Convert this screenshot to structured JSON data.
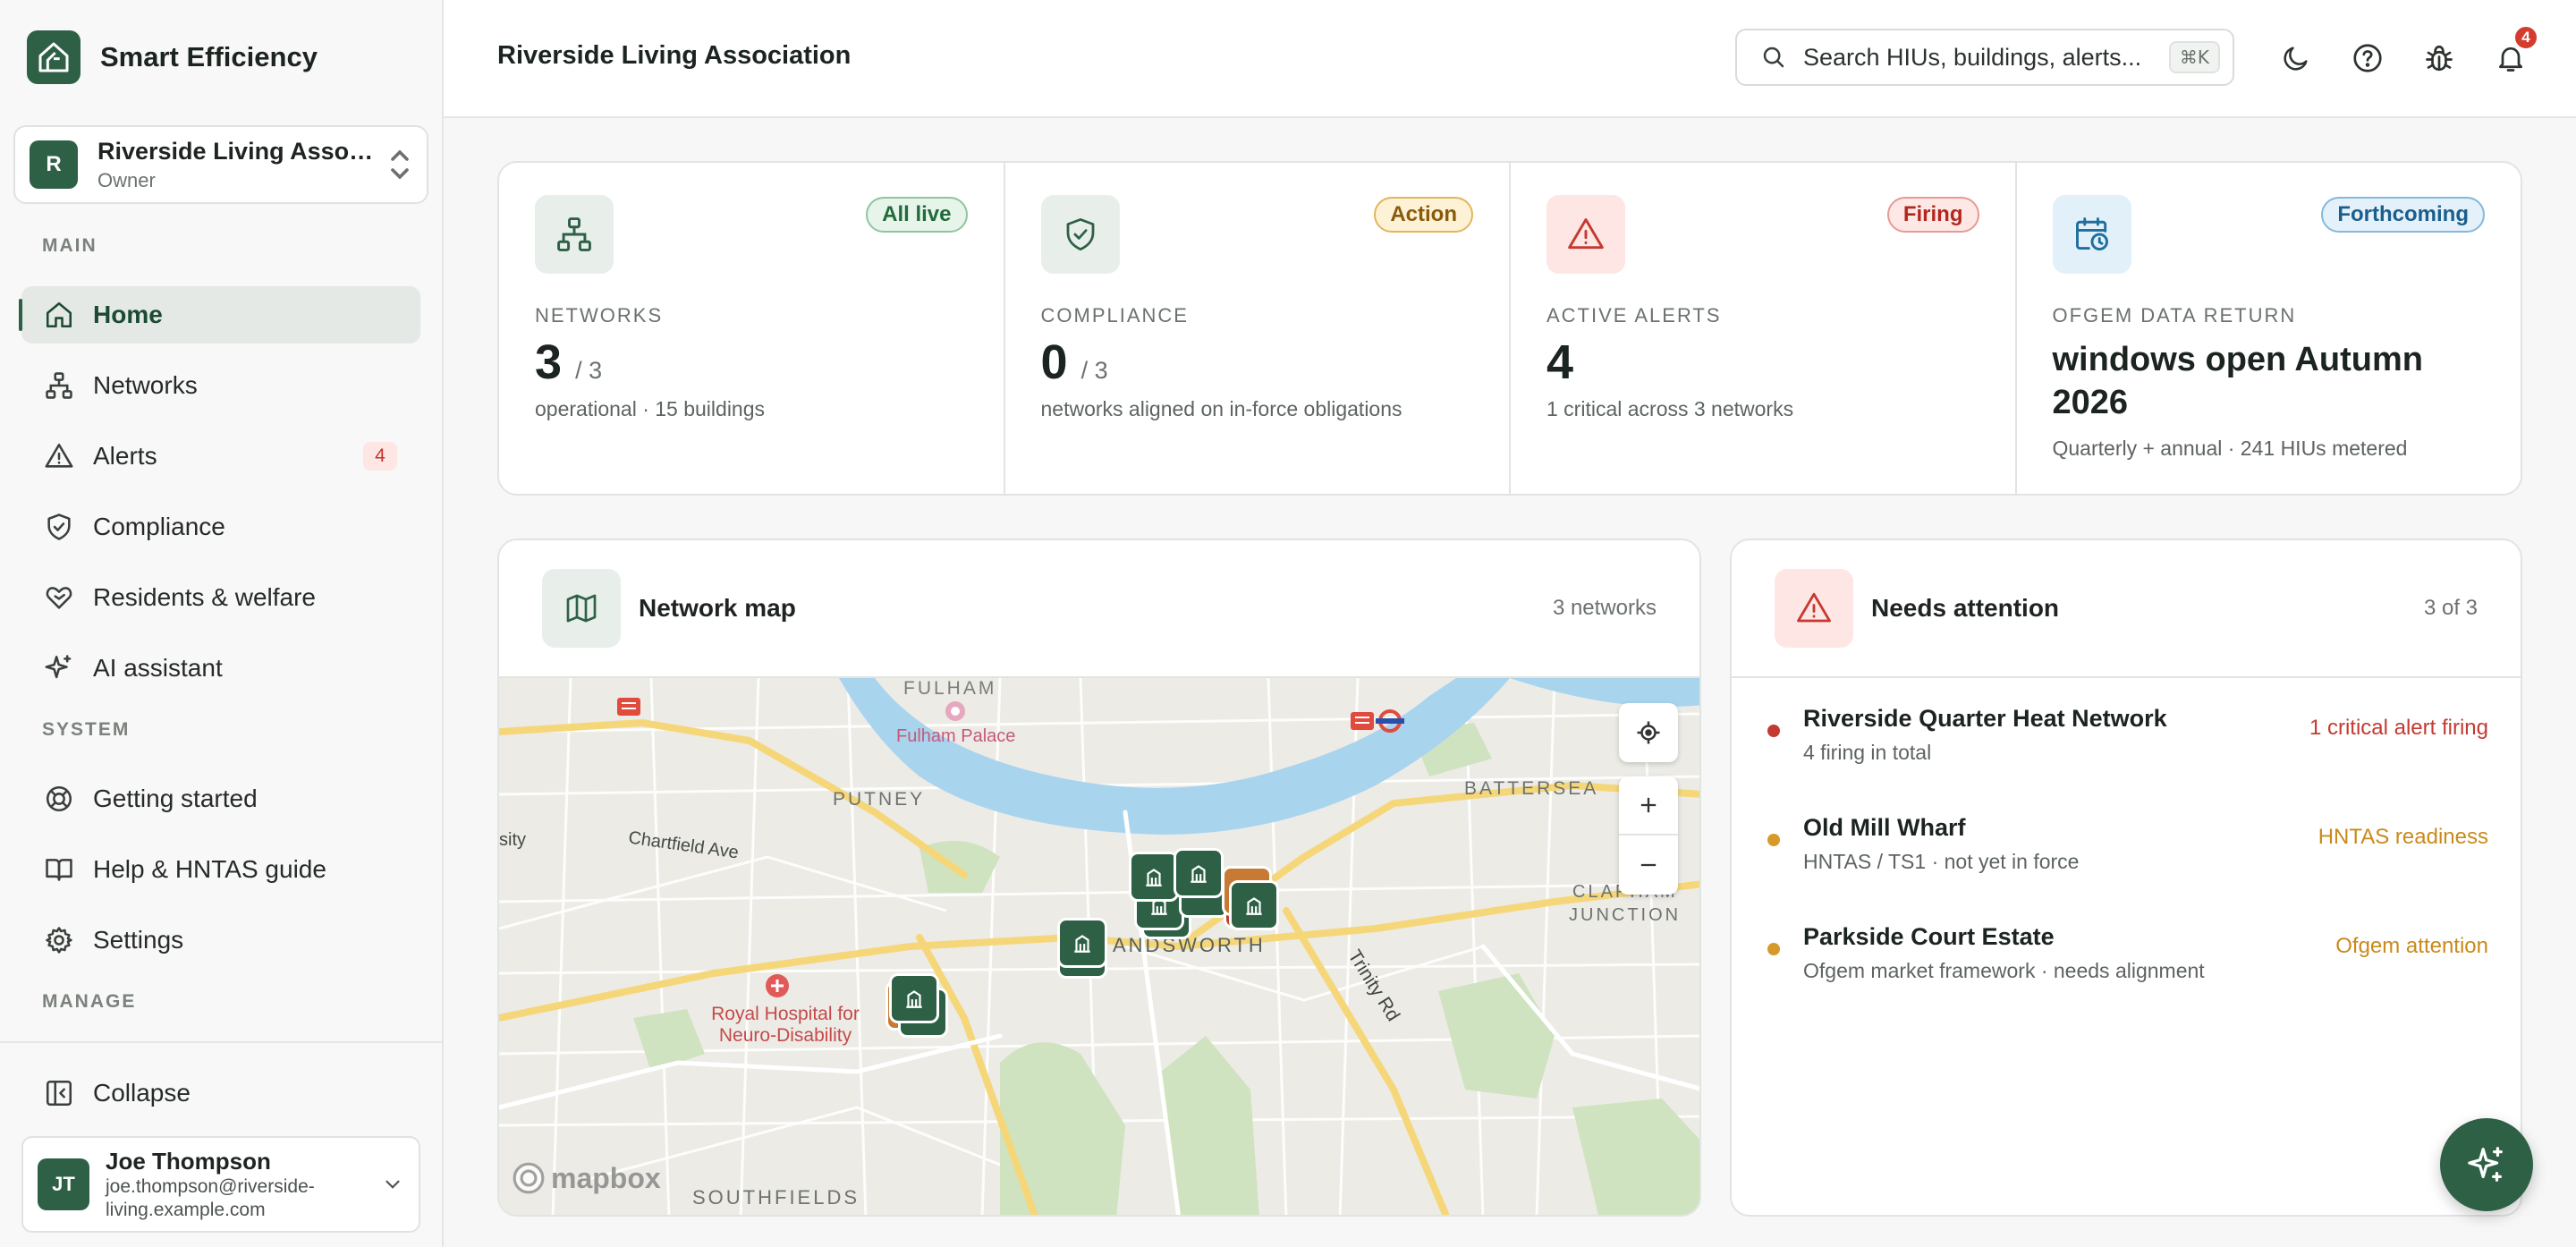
{
  "app": {
    "name": "Smart Efficiency"
  },
  "org": {
    "initial": "R",
    "name": "Riverside Living Assoc...",
    "role": "Owner"
  },
  "nav": {
    "main_label": "MAIN",
    "system_label": "SYSTEM",
    "manage_label": "MANAGE",
    "main": [
      {
        "label": "Home",
        "icon": "home-icon",
        "active": true
      },
      {
        "label": "Networks",
        "icon": "network-icon"
      },
      {
        "label": "Alerts",
        "icon": "alert-icon",
        "badge": "4"
      },
      {
        "label": "Compliance",
        "icon": "shield-icon"
      },
      {
        "label": "Residents & welfare",
        "icon": "heart-hand-icon"
      },
      {
        "label": "AI assistant",
        "icon": "sparkle-icon"
      }
    ],
    "system": [
      {
        "label": "Getting started",
        "icon": "lifebuoy-icon"
      },
      {
        "label": "Help & HNTAS guide",
        "icon": "book-icon"
      },
      {
        "label": "Settings",
        "icon": "gear-icon"
      }
    ],
    "collapse_label": "Collapse"
  },
  "user": {
    "initials": "JT",
    "name": "Joe Thompson",
    "email_line1": "joe.thompson@riverside-",
    "email_line2": "living.example.com"
  },
  "header": {
    "title": "Riverside Living Association",
    "search_placeholder": "Search HIUs, buildings, alerts...",
    "search_shortcut": "⌘K",
    "notification_count": "4"
  },
  "kpis": [
    {
      "label": "NETWORKS",
      "value": "3",
      "denominator": "/ 3",
      "sub": "operational · 15 buildings",
      "pill": "All live",
      "icon": "network-icon"
    },
    {
      "label": "COMPLIANCE",
      "value": "0",
      "denominator": "/ 3",
      "sub": "networks aligned on in-force obligations",
      "pill": "Action",
      "icon": "shield-check-icon"
    },
    {
      "label": "ACTIVE ALERTS",
      "value": "4",
      "sub": "1 critical across 3 networks",
      "pill": "Firing",
      "icon": "alert-triangle-icon"
    },
    {
      "label": "OFGEM DATA RETURN",
      "value_line1": "windows open Autumn",
      "value_line2": "2026",
      "sub": "Quarterly + annual · 241 HIUs metered",
      "pill": "Forthcoming",
      "icon": "calendar-clock-icon"
    }
  ],
  "map_card": {
    "title": "Network map",
    "meta": "3 networks",
    "labels": {
      "fulham": "FULHAM",
      "fulham_palace": "Fulham Palace",
      "putney": "PUTNEY",
      "battersea": "BATTERSEA",
      "chartfield": "Chartfield Ave",
      "sity": "sity",
      "wandsworth": "ANDSWORTH",
      "trinity": "Trinity Rd",
      "clapham": "CLAPHAM",
      "junction": "JUNCTION",
      "royal1": "Royal Hospital for",
      "royal2": "Neuro-Disability",
      "southfields": "SOUTHFIELDS",
      "mapbox": "mapbox",
      "atter": "atter"
    }
  },
  "attention": {
    "title": "Needs attention",
    "meta": "3 of 3",
    "items": [
      {
        "title": "Riverside Quarter Heat Network",
        "sub": "4 firing in total",
        "status": "1 critical alert firing",
        "color": "#c43a30"
      },
      {
        "title": "Old Mill Wharf",
        "sub": "HNTAS / TS1 · not yet in force",
        "status": "HNTAS readiness",
        "color": "#d69a2a"
      },
      {
        "title": "Parkside Court Estate",
        "sub": "Ofgem market framework · needs alignment",
        "status": "Ofgem attention",
        "color": "#d69a2a"
      }
    ]
  }
}
